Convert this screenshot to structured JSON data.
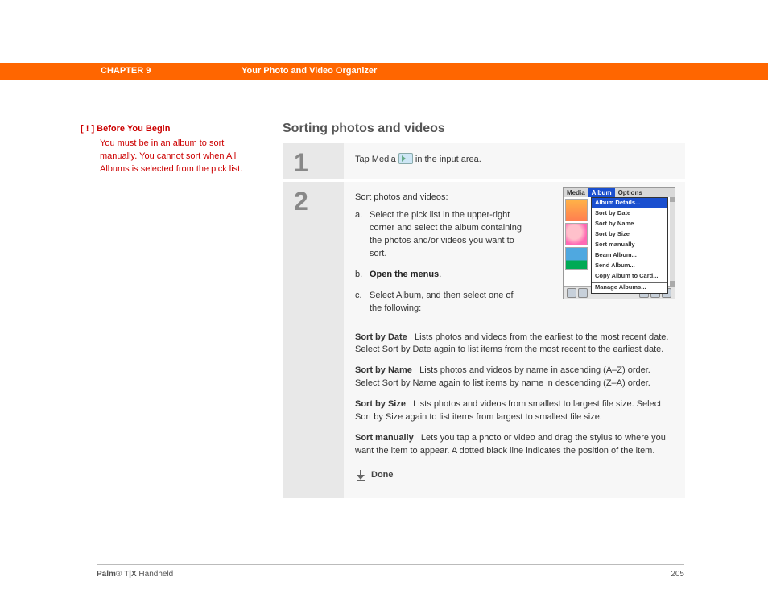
{
  "header": {
    "chapter": "CHAPTER 9",
    "title": "Your Photo and Video Organizer"
  },
  "sidebar": {
    "marker": "[ ! ]",
    "title": "Before You Begin",
    "body": "You must be in an album to sort manually. You cannot sort when All Albums is selected from the pick list."
  },
  "section_title": "Sorting photos and videos",
  "step1": {
    "num": "1",
    "pre": "Tap Media ",
    "post": " in the input area."
  },
  "step2": {
    "num": "2",
    "intro": "Sort photos and videos:",
    "a_letter": "a.",
    "a_text": "Select the pick list in the upper-right corner and select the album containing the photos and/or videos you want to sort.",
    "b_letter": "b.",
    "b_link": "Open the menus",
    "b_after": ".",
    "c_letter": "c.",
    "c_text": "Select Album, and then select one of the following:",
    "sort_date_label": "Sort by Date",
    "sort_date_text": "Lists photos and videos from the earliest to the most recent date. Select Sort by Date again to list items from the most recent to the earliest date.",
    "sort_name_label": "Sort by Name",
    "sort_name_text": "Lists photos and videos by name in ascending (A–Z) order. Select Sort by Name again to list items by name in descending (Z–A) order.",
    "sort_size_label": "Sort by Size",
    "sort_size_text": "Lists photos and videos from smallest to largest file size. Select Sort by Size again to list items from largest to smallest file size.",
    "sort_manual_label": "Sort manually",
    "sort_manual_text": "Lets you tap a photo or video and drag the stylus to where you want the item to appear. A dotted black line indicates the position of the item.",
    "done": "Done"
  },
  "palm": {
    "menu_media": "Media",
    "menu_album": "Album",
    "menu_options": "Options",
    "mi_details": "Album Details...",
    "mi_date": "Sort by Date",
    "mi_name": "Sort by Name",
    "mi_size": "Sort by Size",
    "mi_manual": "Sort manually",
    "mi_beam": "Beam Album...",
    "mi_send": "Send Album...",
    "mi_copy": "Copy Album to Card...",
    "mi_manage": "Manage Albums..."
  },
  "chart_data": {
    "type": "table",
    "title": "Album menu items (Palm Media app)",
    "categories": [
      "Album Details...",
      "Sort by Date",
      "Sort by Name",
      "Sort by Size",
      "Sort manually",
      "Beam Album...",
      "Send Album...",
      "Copy Album to Card...",
      "Manage Albums..."
    ]
  },
  "footer": {
    "brand": "Palm",
    "reg": "®",
    "model": " T|X",
    "suffix": " Handheld",
    "page": "205"
  }
}
